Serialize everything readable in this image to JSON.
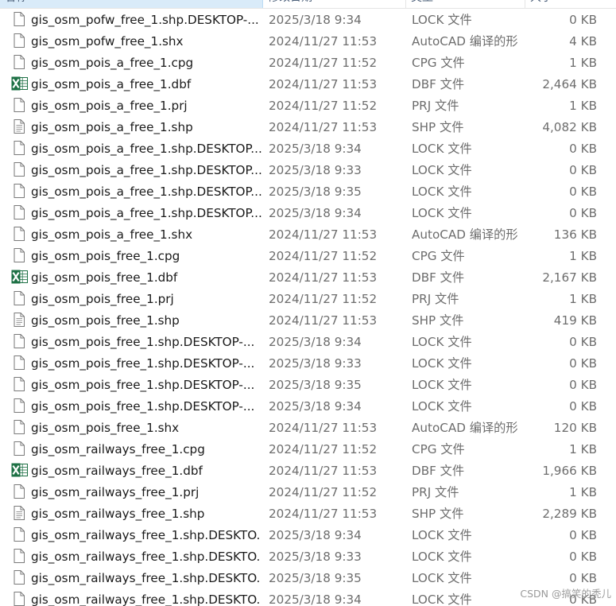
{
  "header": {
    "name": "名称",
    "date": "修改日期",
    "type": "类型",
    "size": "大小"
  },
  "files": [
    {
      "name": "gis_osm_pofw_free_1.shp.DESKTOP-...",
      "date": "2025/3/18 9:34",
      "type": "LOCK 文件",
      "size": "0 KB",
      "icon": "blank-file-icon"
    },
    {
      "name": "gis_osm_pofw_free_1.shx",
      "date": "2024/11/27 11:53",
      "type": "AutoCAD 编译的形",
      "size": "4 KB",
      "icon": "blank-file-icon"
    },
    {
      "name": "gis_osm_pois_a_free_1.cpg",
      "date": "2024/11/27 11:52",
      "type": "CPG 文件",
      "size": "1 KB",
      "icon": "blank-file-icon"
    },
    {
      "name": "gis_osm_pois_a_free_1.dbf",
      "date": "2024/11/27 11:53",
      "type": "DBF 文件",
      "size": "2,464 KB",
      "icon": "excel-icon"
    },
    {
      "name": "gis_osm_pois_a_free_1.prj",
      "date": "2024/11/27 11:52",
      "type": "PRJ 文件",
      "size": "1 KB",
      "icon": "blank-file-icon"
    },
    {
      "name": "gis_osm_pois_a_free_1.shp",
      "date": "2024/11/27 11:53",
      "type": "SHP 文件",
      "size": "4,082 KB",
      "icon": "text-file-icon"
    },
    {
      "name": "gis_osm_pois_a_free_1.shp.DESKTOP...",
      "date": "2025/3/18 9:34",
      "type": "LOCK 文件",
      "size": "0 KB",
      "icon": "blank-file-icon"
    },
    {
      "name": "gis_osm_pois_a_free_1.shp.DESKTOP...",
      "date": "2025/3/18 9:33",
      "type": "LOCK 文件",
      "size": "0 KB",
      "icon": "blank-file-icon"
    },
    {
      "name": "gis_osm_pois_a_free_1.shp.DESKTOP...",
      "date": "2025/3/18 9:35",
      "type": "LOCK 文件",
      "size": "0 KB",
      "icon": "blank-file-icon"
    },
    {
      "name": "gis_osm_pois_a_free_1.shp.DESKTOP...",
      "date": "2025/3/18 9:34",
      "type": "LOCK 文件",
      "size": "0 KB",
      "icon": "blank-file-icon"
    },
    {
      "name": "gis_osm_pois_a_free_1.shx",
      "date": "2024/11/27 11:53",
      "type": "AutoCAD 编译的形",
      "size": "136 KB",
      "icon": "blank-file-icon"
    },
    {
      "name": "gis_osm_pois_free_1.cpg",
      "date": "2024/11/27 11:52",
      "type": "CPG 文件",
      "size": "1 KB",
      "icon": "blank-file-icon"
    },
    {
      "name": "gis_osm_pois_free_1.dbf",
      "date": "2024/11/27 11:53",
      "type": "DBF 文件",
      "size": "2,167 KB",
      "icon": "excel-icon"
    },
    {
      "name": "gis_osm_pois_free_1.prj",
      "date": "2024/11/27 11:52",
      "type": "PRJ 文件",
      "size": "1 KB",
      "icon": "blank-file-icon"
    },
    {
      "name": "gis_osm_pois_free_1.shp",
      "date": "2024/11/27 11:53",
      "type": "SHP 文件",
      "size": "419 KB",
      "icon": "text-file-icon"
    },
    {
      "name": "gis_osm_pois_free_1.shp.DESKTOP-...",
      "date": "2025/3/18 9:34",
      "type": "LOCK 文件",
      "size": "0 KB",
      "icon": "blank-file-icon"
    },
    {
      "name": "gis_osm_pois_free_1.shp.DESKTOP-...",
      "date": "2025/3/18 9:33",
      "type": "LOCK 文件",
      "size": "0 KB",
      "icon": "blank-file-icon"
    },
    {
      "name": "gis_osm_pois_free_1.shp.DESKTOP-...",
      "date": "2025/3/18 9:35",
      "type": "LOCK 文件",
      "size": "0 KB",
      "icon": "blank-file-icon"
    },
    {
      "name": "gis_osm_pois_free_1.shp.DESKTOP-...",
      "date": "2025/3/18 9:34",
      "type": "LOCK 文件",
      "size": "0 KB",
      "icon": "blank-file-icon"
    },
    {
      "name": "gis_osm_pois_free_1.shx",
      "date": "2024/11/27 11:53",
      "type": "AutoCAD 编译的形",
      "size": "120 KB",
      "icon": "blank-file-icon"
    },
    {
      "name": "gis_osm_railways_free_1.cpg",
      "date": "2024/11/27 11:52",
      "type": "CPG 文件",
      "size": "1 KB",
      "icon": "blank-file-icon"
    },
    {
      "name": "gis_osm_railways_free_1.dbf",
      "date": "2024/11/27 11:53",
      "type": "DBF 文件",
      "size": "1,966 KB",
      "icon": "excel-icon"
    },
    {
      "name": "gis_osm_railways_free_1.prj",
      "date": "2024/11/27 11:52",
      "type": "PRJ 文件",
      "size": "1 KB",
      "icon": "blank-file-icon"
    },
    {
      "name": "gis_osm_railways_free_1.shp",
      "date": "2024/11/27 11:53",
      "type": "SHP 文件",
      "size": "2,289 KB",
      "icon": "text-file-icon"
    },
    {
      "name": "gis_osm_railways_free_1.shp.DESKTO...",
      "date": "2025/3/18 9:34",
      "type": "LOCK 文件",
      "size": "0 KB",
      "icon": "blank-file-icon"
    },
    {
      "name": "gis_osm_railways_free_1.shp.DESKTO...",
      "date": "2025/3/18 9:33",
      "type": "LOCK 文件",
      "size": "0 KB",
      "icon": "blank-file-icon"
    },
    {
      "name": "gis_osm_railways_free_1.shp.DESKTO...",
      "date": "2025/3/18 9:35",
      "type": "LOCK 文件",
      "size": "0 KB",
      "icon": "blank-file-icon"
    },
    {
      "name": "gis_osm_railways_free_1.shp.DESKTO...",
      "date": "2025/3/18 9:34",
      "type": "LOCK 文件",
      "size": "0 KB",
      "icon": "blank-file-icon"
    }
  ],
  "watermark": "CSDN @搞笑的秃儿",
  "colors": {
    "header_selected_bg": "#d9ebf9",
    "excel_green": "#1e7145",
    "meta_text": "#6d6d6d"
  }
}
